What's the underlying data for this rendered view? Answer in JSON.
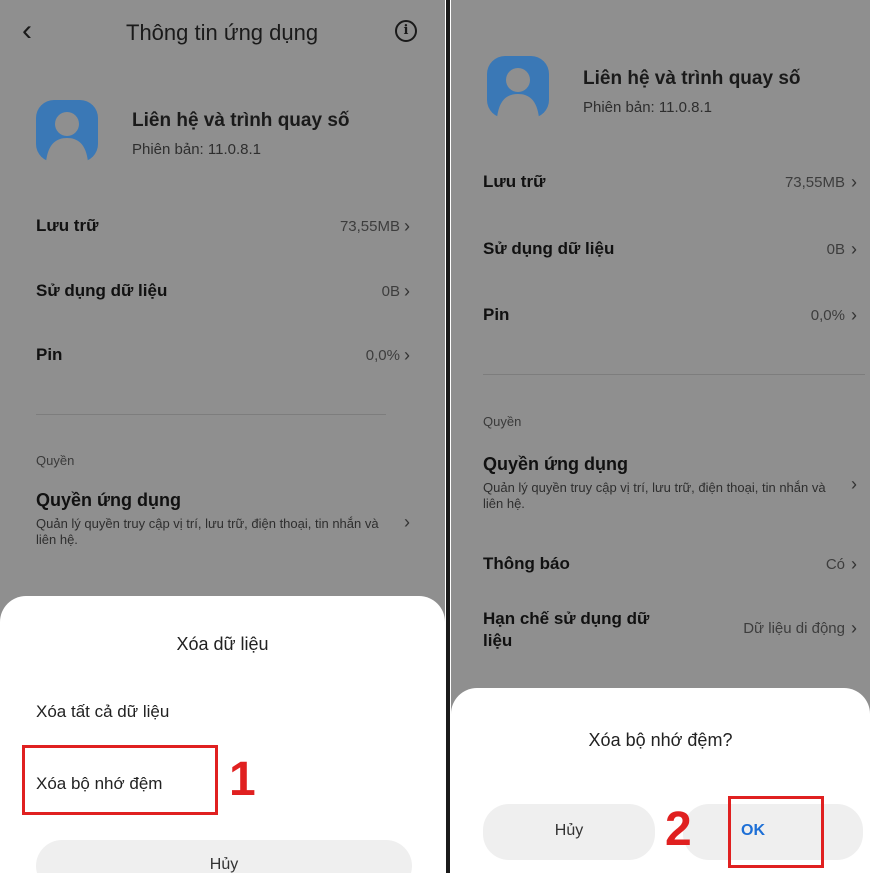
{
  "left": {
    "header": {
      "back_glyph": "‹",
      "title": "Thông tin ứng dụng",
      "info_glyph": "i"
    },
    "app": {
      "name": "Liên hệ và trình quay số",
      "version": "Phiên bản: 11.0.8.1"
    },
    "rows": [
      {
        "label": "Lưu trữ",
        "value": "73,55MB"
      },
      {
        "label": "Sử dụng dữ liệu",
        "value": "0B"
      },
      {
        "label": "Pin",
        "value": "0,0%"
      }
    ],
    "section_label": "Quyền",
    "permissions": {
      "title": "Quyền ứng dụng",
      "desc": "Quản lý quyền truy cập vị trí, lưu trữ, điện thoại, tin nhắn và liên hệ."
    },
    "sheet": {
      "title": "Xóa dữ liệu",
      "options": [
        "Xóa tất cả dữ liệu",
        "Xóa bộ nhớ đệm"
      ],
      "cancel": "Hủy"
    },
    "step": "1"
  },
  "right": {
    "app": {
      "name": "Liên hệ và trình quay số",
      "version": "Phiên bản: 11.0.8.1"
    },
    "rows": [
      {
        "label": "Lưu trữ",
        "value": "73,55MB"
      },
      {
        "label": "Sử dụng dữ liệu",
        "value": "0B"
      },
      {
        "label": "Pin",
        "value": "0,0%"
      }
    ],
    "section_label": "Quyền",
    "permissions": {
      "title": "Quyền ứng dụng",
      "desc": "Quản lý quyền truy cập vị trí, lưu trữ, điện thoại, tin nhắn và liên hệ."
    },
    "notifications": {
      "label": "Thông báo",
      "value": "Có"
    },
    "data_limit": {
      "label": "Hạn chế sử dụng dữ liệu",
      "value": "Dữ liệu di động"
    },
    "dialog": {
      "title": "Xóa bộ nhớ đệm?",
      "cancel": "Hủy",
      "ok": "OK"
    },
    "step": "2"
  },
  "chevron_glyph": "›",
  "colors": {
    "screen_dim": "#8f8f8f",
    "icon_blue": "#3a78b6",
    "highlight_red": "#e02020",
    "ok_blue": "#1d6fd6"
  },
  "icons": {
    "app": "contact-person-icon",
    "info": "info-circle-icon",
    "back": "back-arrow-icon"
  }
}
